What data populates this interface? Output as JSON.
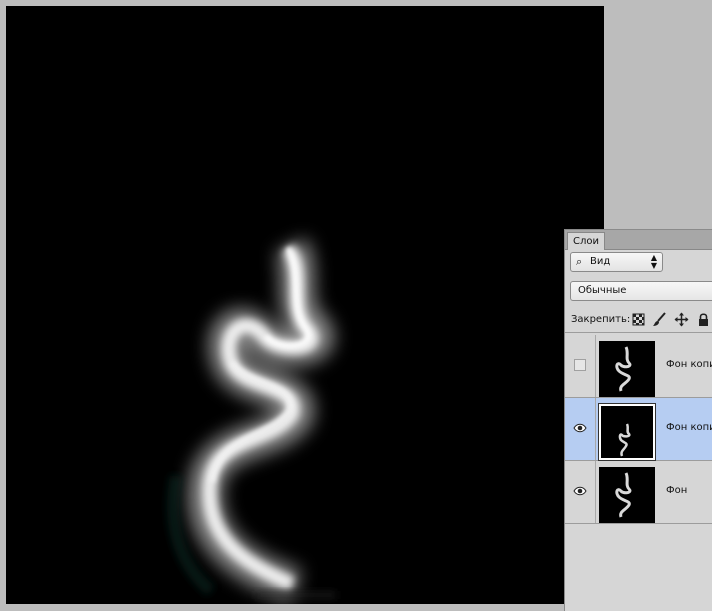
{
  "canvas": {
    "background": "#000000"
  },
  "layers_panel": {
    "tab_label": "Слои",
    "filter_label": "Вид",
    "blend_mode": "Обычные",
    "lock_label": "Закрепить:",
    "lock_icons": [
      "lock-transparent-pixels-icon",
      "lock-image-pixels-icon",
      "lock-position-icon",
      "lock-all-icon"
    ],
    "layers": [
      {
        "name": "Фон копия",
        "visible": false,
        "selected": false
      },
      {
        "name": "Фон копия",
        "visible": true,
        "selected": true
      },
      {
        "name": "Фон",
        "visible": true,
        "selected": false
      }
    ],
    "selected_color": "#b6cdf2"
  }
}
